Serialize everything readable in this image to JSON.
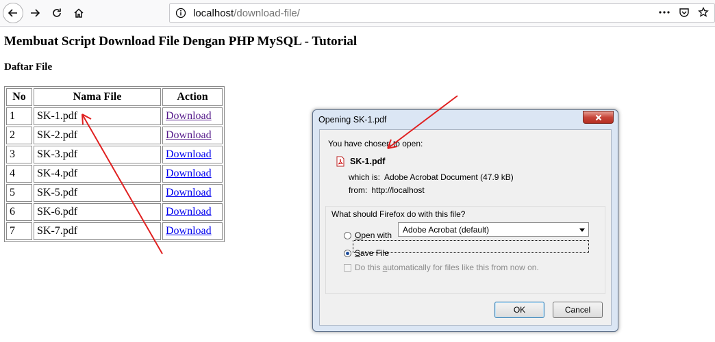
{
  "browser": {
    "url_host": "localhost",
    "url_path": "/download-file/"
  },
  "page": {
    "title": "Membuat Script Download File Dengan PHP MySQL - Tutorial",
    "section": "Daftar File",
    "table": {
      "headers": [
        "No",
        "Nama File",
        "Action"
      ],
      "rows": [
        {
          "no": "1",
          "name": "SK-1.pdf",
          "action": "Download"
        },
        {
          "no": "2",
          "name": "SK-2.pdf",
          "action": "Download"
        },
        {
          "no": "3",
          "name": "SK-3.pdf",
          "action": "Download"
        },
        {
          "no": "4",
          "name": "SK-4.pdf",
          "action": "Download"
        },
        {
          "no": "5",
          "name": "SK-5.pdf",
          "action": "Download"
        },
        {
          "no": "6",
          "name": "SK-6.pdf",
          "action": "Download"
        },
        {
          "no": "7",
          "name": "SK-7.pdf",
          "action": "Download"
        }
      ]
    }
  },
  "dialog": {
    "title": "Opening SK-1.pdf",
    "chosen_label": "You have chosen to open:",
    "file_name": "SK-1.pdf",
    "which_label": "which is:",
    "which_value": "Adobe Acrobat Document (47.9 kB)",
    "from_label": "from:",
    "from_value": "http://localhost",
    "question": "What should Firefox do with this file?",
    "open_with_pre": "",
    "open_with_acc": "O",
    "open_with_post": "pen with",
    "open_with_app": "Adobe Acrobat  (default)",
    "save_acc": "S",
    "save_post": "ave File",
    "auto_pre": "Do this ",
    "auto_acc": "a",
    "auto_post": "utomatically for files like this from now on.",
    "ok_label": "OK",
    "cancel_label": "Cancel"
  },
  "colors": {
    "link": "#0000ee",
    "visited_link": "#551a8b",
    "annotation": "#e02020"
  }
}
